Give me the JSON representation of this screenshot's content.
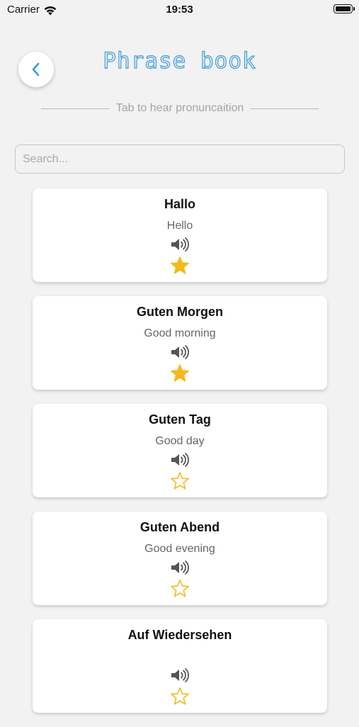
{
  "status_bar": {
    "carrier": "Carrier",
    "time": "19:53"
  },
  "header": {
    "back_icon": "chevron-left-icon",
    "title": "Phrase book",
    "subtitle": "Tab to hear pronuncaition"
  },
  "search": {
    "placeholder": "Search...",
    "value": ""
  },
  "colors": {
    "accent": "#3e9ad8",
    "star": "#f3b91d",
    "background": "#f2f2f2"
  },
  "phrases": [
    {
      "title": "Hallo",
      "translation": "Hello",
      "favorite": true
    },
    {
      "title": "Guten Morgen",
      "translation": "Good morning",
      "favorite": true
    },
    {
      "title": "Guten Tag",
      "translation": "Good day",
      "favorite": false
    },
    {
      "title": "Guten Abend",
      "translation": "Good evening",
      "favorite": false
    },
    {
      "title": "Auf Wiedersehen",
      "translation": "",
      "favorite": false
    }
  ]
}
